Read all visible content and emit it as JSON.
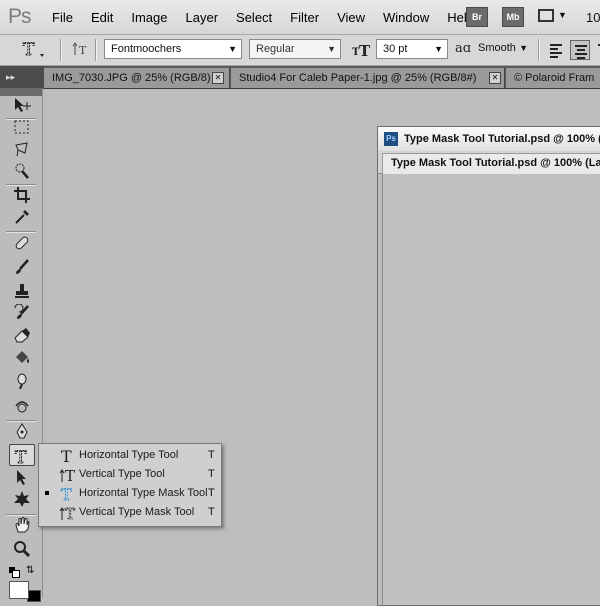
{
  "app": {
    "logo": "Ps"
  },
  "menu": [
    "File",
    "Edit",
    "Image",
    "Layer",
    "Select",
    "Filter",
    "View",
    "Window",
    "Help"
  ],
  "menubar_right": {
    "bridge": "Br",
    "mini_bridge": "Mb",
    "zoom": "10"
  },
  "options": {
    "font_family": "Fontmoochers",
    "font_style": "Regular",
    "font_size": "30 pt",
    "aa_label": "aɑ",
    "antialias": "Smooth"
  },
  "tabs": [
    {
      "label": "IMG_7030.JPG @ 25% (RGB/8)"
    },
    {
      "label": "Studio4 For Caleb Paper-1.jpg @ 25% (RGB/8#)"
    },
    {
      "label": "© Polaroid Fram"
    }
  ],
  "flyout": {
    "items": [
      {
        "label": "Horizontal Type Tool",
        "key": "T"
      },
      {
        "label": "Vertical Type Tool",
        "key": "T"
      },
      {
        "label": "Horizontal Type Mask Tool",
        "key": "T"
      },
      {
        "label": "Vertical Type Mask Tool",
        "key": "T"
      }
    ]
  },
  "document": {
    "title": "Type Mask Tool Tutorial.psd @ 100% (",
    "tab_label": "Type Mask Tool Tutorial.psd @ 100% (La"
  }
}
